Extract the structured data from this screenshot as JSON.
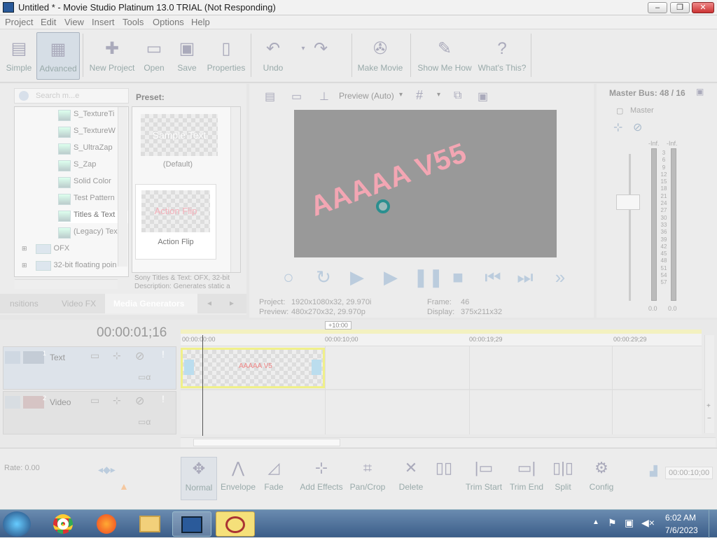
{
  "window": {
    "title": "Untitled * - Movie Studio Platinum 13.0 TRIAL (Not Responding)"
  },
  "menu": [
    "Project",
    "Edit",
    "View",
    "Insert",
    "Tools",
    "Options",
    "Help"
  ],
  "toolbar": {
    "simple": "Simple",
    "advanced": "Advanced",
    "new_project": "New Project",
    "open": "Open",
    "save": "Save",
    "properties": "Properties",
    "undo": "Undo",
    "make_movie": "Make Movie",
    "show_me_how": "Show Me How",
    "whats_this": "What's This?"
  },
  "explorer": {
    "search_placeholder": "Search m...e",
    "items": [
      "S_TextureTi",
      "S_TextureW",
      "S_UltraZap",
      "S_Zap",
      "Solid Color",
      "Test Pattern",
      "Titles & Text",
      "(Legacy) Tex",
      "OFX",
      "32-bit floating poin"
    ]
  },
  "presets": {
    "header": "Preset:",
    "items": [
      {
        "thumb": "Sample Text",
        "label": "(Default)"
      },
      {
        "thumb": "Action Flip",
        "label": "Action Flip"
      }
    ],
    "desc1": "Sony Titles & Text: OFX, 32-bit",
    "desc2": "Description: Generates static a"
  },
  "tabs": {
    "t1": "nsitions",
    "t2": "Video FX",
    "t3": "Media Generators"
  },
  "preview": {
    "mode": "Preview (Auto)",
    "video_text": "AAAAA V55",
    "project_label": "Project:",
    "project_val": "1920x1080x32, 29.970i",
    "preview_label": "Preview:",
    "preview_val": "480x270x32, 29.970p",
    "frame_label": "Frame:",
    "frame_val": "46",
    "display_label": "Display:",
    "display_val": "375x211x32"
  },
  "master": {
    "title": "Master Bus: 48 / 16",
    "label": "Master",
    "inf_l": "-Inf.",
    "inf_r": "-Inf.",
    "ticks": [
      "3",
      "6",
      "9",
      "12",
      "15",
      "18",
      "21",
      "24",
      "27",
      "30",
      "33",
      "36",
      "39",
      "42",
      "45",
      "48",
      "51",
      "54",
      "57"
    ],
    "bottom_l": "0.0",
    "bottom_r": "0.0"
  },
  "timeline": {
    "timecode": "00:00:01;16",
    "offset": "+10:00",
    "ruler": [
      "00:00:00:00",
      "00:00:10;00",
      "00:00:19;29",
      "00:00:29;29"
    ],
    "track1_num": "1",
    "track1_name": "Text",
    "track2_num": "2",
    "track2_name": "Video",
    "clip_label": "AAAAA V5",
    "rate": "Rate: 0.00",
    "end_time": "00:00:10;00"
  },
  "bottom": {
    "normal": "Normal",
    "envelope": "Envelope",
    "fade": "Fade",
    "add_effects": "Add Effects",
    "pan_crop": "Pan/Crop",
    "delete": "Delete",
    "trim_start": "Trim Start",
    "trim_end": "Trim End",
    "split": "Split",
    "config": "Config"
  },
  "taskbar": {
    "time": "6:02 AM",
    "date": "7/6/2023"
  }
}
